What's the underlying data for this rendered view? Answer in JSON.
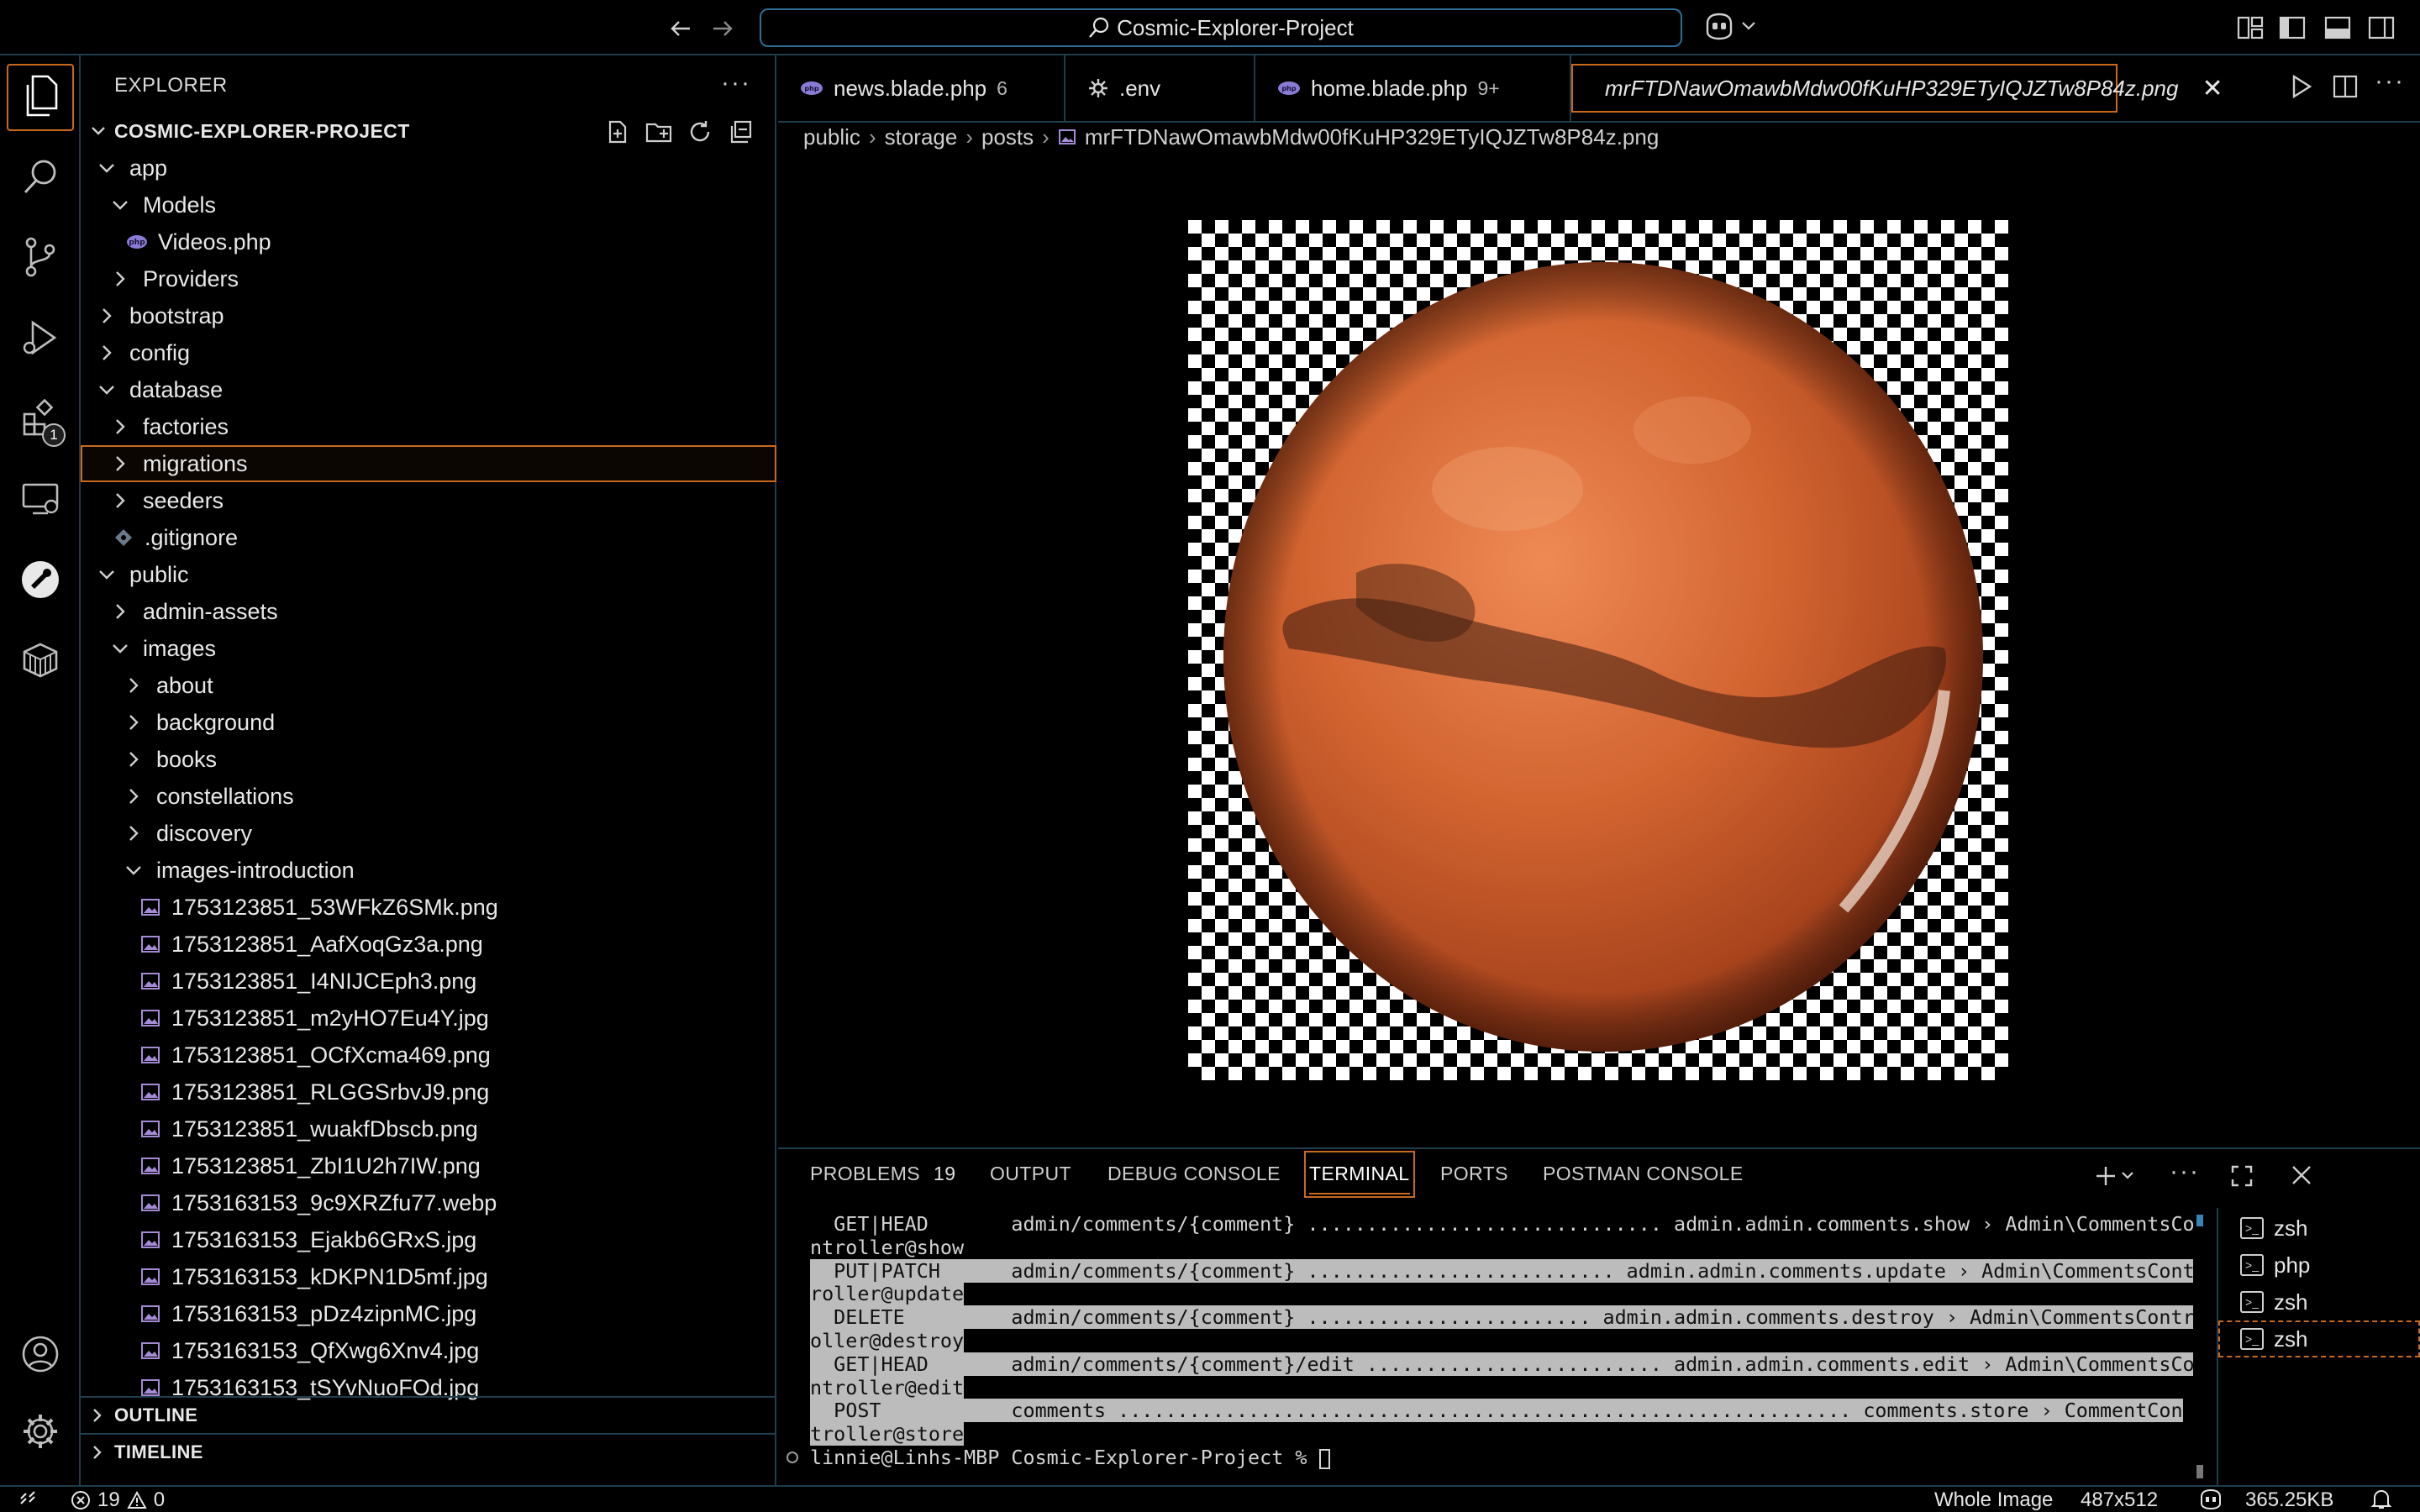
{
  "titlebar": {
    "search_text": "Cosmic-Explorer-Project"
  },
  "activitybar": {
    "extensions_badge": "1"
  },
  "sidebar": {
    "title": "EXPLORER",
    "more": "···",
    "project": "COSMIC-EXPLORER-PROJECT",
    "tree": [
      {
        "label": "app",
        "depth": 0,
        "kind": "folder-open"
      },
      {
        "label": "Models",
        "depth": 1,
        "kind": "folder-open"
      },
      {
        "label": "Videos.php",
        "depth": 2,
        "kind": "php"
      },
      {
        "label": "Providers",
        "depth": 1,
        "kind": "folder"
      },
      {
        "label": "bootstrap",
        "depth": 0,
        "kind": "folder"
      },
      {
        "label": "config",
        "depth": 0,
        "kind": "folder"
      },
      {
        "label": "database",
        "depth": 0,
        "kind": "folder-open"
      },
      {
        "label": "factories",
        "depth": 1,
        "kind": "folder"
      },
      {
        "label": "migrations",
        "depth": 1,
        "kind": "folder",
        "selected": true
      },
      {
        "label": "seeders",
        "depth": 1,
        "kind": "folder"
      },
      {
        "label": ".gitignore",
        "depth": 1,
        "kind": "git"
      },
      {
        "label": "public",
        "depth": 0,
        "kind": "folder-open"
      },
      {
        "label": "admin-assets",
        "depth": 1,
        "kind": "folder"
      },
      {
        "label": "images",
        "depth": 1,
        "kind": "folder-open"
      },
      {
        "label": "about",
        "depth": 2,
        "kind": "folder"
      },
      {
        "label": "background",
        "depth": 2,
        "kind": "folder"
      },
      {
        "label": "books",
        "depth": 2,
        "kind": "folder"
      },
      {
        "label": "constellations",
        "depth": 2,
        "kind": "folder"
      },
      {
        "label": "discovery",
        "depth": 2,
        "kind": "folder"
      },
      {
        "label": "images-introduction",
        "depth": 2,
        "kind": "folder-open"
      },
      {
        "label": "1753123851_53WFkZ6SMk.png",
        "depth": 3,
        "kind": "image"
      },
      {
        "label": "1753123851_AafXoqGz3a.png",
        "depth": 3,
        "kind": "image"
      },
      {
        "label": "1753123851_I4NIJCEph3.png",
        "depth": 3,
        "kind": "image"
      },
      {
        "label": "1753123851_m2yHO7Eu4Y.jpg",
        "depth": 3,
        "kind": "image"
      },
      {
        "label": "1753123851_OCfXcma469.png",
        "depth": 3,
        "kind": "image"
      },
      {
        "label": "1753123851_RLGGSrbvJ9.png",
        "depth": 3,
        "kind": "image"
      },
      {
        "label": "1753123851_wuakfDbscb.png",
        "depth": 3,
        "kind": "image"
      },
      {
        "label": "1753123851_ZbI1U2h7IW.png",
        "depth": 3,
        "kind": "image"
      },
      {
        "label": "1753163153_9c9XRZfu77.webp",
        "depth": 3,
        "kind": "image"
      },
      {
        "label": "1753163153_Ejakb6GRxS.jpg",
        "depth": 3,
        "kind": "image"
      },
      {
        "label": "1753163153_kDKPN1D5mf.jpg",
        "depth": 3,
        "kind": "image"
      },
      {
        "label": "1753163153_pDz4zipnMC.jpg",
        "depth": 3,
        "kind": "image"
      },
      {
        "label": "1753163153_QfXwg6Xnv4.jpg",
        "depth": 3,
        "kind": "image"
      },
      {
        "label": "1753163153_tSYvNuoFOd.jpg",
        "depth": 3,
        "kind": "image"
      }
    ],
    "outline": "OUTLINE",
    "timeline": "TIMELINE"
  },
  "tabs": [
    {
      "label": "news.blade.php",
      "modifier": "6",
      "icon": "php-icon"
    },
    {
      "label": ".env",
      "modifier": "",
      "icon": "gear-icon"
    },
    {
      "label": "home.blade.php",
      "modifier": "9+",
      "icon": "php-icon"
    },
    {
      "label": "mrFTDNawOmawbMdw00fKuHP329ETyIQJZTw8P84z.png",
      "modifier": "",
      "icon": "image-icon",
      "active": true
    }
  ],
  "breadcrumb": [
    "public",
    "storage",
    "posts",
    "mrFTDNawOmawbMdw00fKuHP329ETyIQJZTw8P84z.png"
  ],
  "panel": {
    "tabs": [
      {
        "label": "PROBLEMS",
        "count": "19"
      },
      {
        "label": "OUTPUT",
        "count": ""
      },
      {
        "label": "DEBUG CONSOLE",
        "count": ""
      },
      {
        "label": "TERMINAL",
        "count": "",
        "active": true
      },
      {
        "label": "PORTS",
        "count": ""
      },
      {
        "label": "POSTMAN CONSOLE",
        "count": ""
      }
    ],
    "terminal_lines": [
      "  GET|HEAD       admin/comments/{comment} .............................. admin.admin.comments.show › Admin\\CommentsCo",
      "ntroller@show",
      "  PUT|PATCH      admin/comments/{comment} .......................... admin.admin.comments.update › Admin\\CommentsCont",
      "roller@update",
      "  DELETE         admin/comments/{comment} ........................ admin.admin.comments.destroy › Admin\\CommentsContr",
      "oller@destroy",
      "  GET|HEAD       admin/comments/{comment}/edit ......................... admin.admin.comments.edit › Admin\\CommentsCo",
      "ntroller@edit",
      "  POST           comments .............................................................. comments.store › CommentCon",
      "troller@store",
      "linnie@Linhs-MBP Cosmic-Explorer-Project % "
    ],
    "terminals": [
      "zsh",
      "php",
      "zsh",
      "zsh"
    ]
  },
  "statusbar": {
    "errors": "19",
    "warnings": "0",
    "view_mode": "Whole Image",
    "dimensions": "487x512",
    "file_size": "365.25KB"
  }
}
